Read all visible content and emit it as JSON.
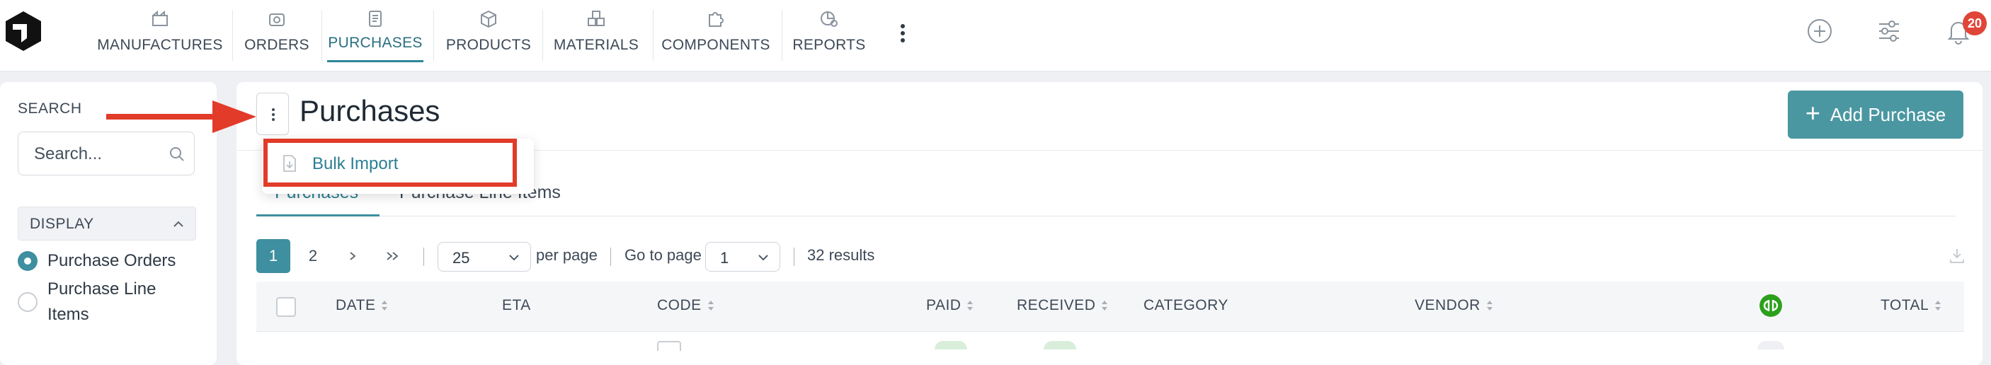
{
  "nav": {
    "items": [
      {
        "label": "MANUFACTURES",
        "icon": "factory-icon"
      },
      {
        "label": "ORDERS",
        "icon": "orders-icon"
      },
      {
        "label": "PURCHASES",
        "icon": "clipboard-icon",
        "active": true
      },
      {
        "label": "PRODUCTS",
        "icon": "box-icon"
      },
      {
        "label": "MATERIALS",
        "icon": "materials-icon"
      },
      {
        "label": "COMPONENTS",
        "icon": "puzzle-icon"
      },
      {
        "label": "REPORTS",
        "icon": "reports-icon"
      }
    ],
    "notification_count": "20"
  },
  "sidebar": {
    "search_label": "SEARCH",
    "search_placeholder": "Search...",
    "display_label": "DISPLAY",
    "options": [
      {
        "label": "Purchase Orders",
        "selected": true
      },
      {
        "label": "Purchase Line Items",
        "selected": false
      }
    ]
  },
  "main": {
    "title": "Purchases",
    "add_button_label": "Add Purchase",
    "menu": {
      "bulk_import_label": "Bulk Import"
    },
    "tabs": [
      {
        "label": "Purchases",
        "active": true
      },
      {
        "label": "Purchase Line Items",
        "active": false
      }
    ],
    "pagination": {
      "pages": [
        "1",
        "2"
      ],
      "current": "1",
      "per_page_value": "25",
      "per_page_label": "per page",
      "go_to_label": "Go to page",
      "go_to_value": "1",
      "results": "32 results"
    },
    "table": {
      "columns": [
        "DATE",
        "ETA",
        "CODE",
        "PAID",
        "RECEIVED",
        "CATEGORY",
        "VENDOR",
        "TOTAL"
      ],
      "qb_icon": "quickbooks-icon"
    }
  },
  "colors": {
    "accent": "#3e8fa0",
    "button": "#4a97a2",
    "badge": "#e0453a",
    "annotation": "#e23b2a",
    "quickbooks": "#2ca01c"
  }
}
